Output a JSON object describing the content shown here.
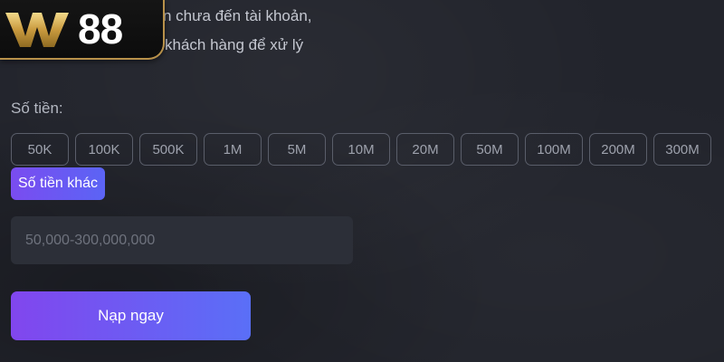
{
  "logo": {
    "text": "88"
  },
  "notice": {
    "line1": "n chưa đến tài khoản,",
    "line2": "khách hàng để xử lý"
  },
  "amount": {
    "label": "Số tiền:",
    "chips": [
      "50K",
      "100K",
      "500K",
      "1M",
      "5M",
      "10M",
      "20M",
      "50M",
      "100M",
      "200M",
      "300M"
    ],
    "other_label": "Số tiền khác",
    "placeholder": "50,000-300,000,000"
  },
  "submit": {
    "label": "Nạp ngay"
  },
  "colors": {
    "accent_start": "#8146ee",
    "accent_end": "#5a6ff7",
    "logo_gold": "#b8914a",
    "background": "#22242c"
  }
}
